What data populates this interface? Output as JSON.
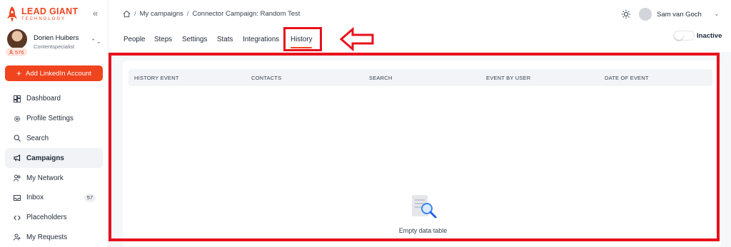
{
  "brand": {
    "name": "LEAD GIANT",
    "tagline": "TECHNOLOGY",
    "accent": "#f0441e"
  },
  "sidebar": {
    "user": {
      "name": "Dorien Huibers",
      "role": "Contentspecialist",
      "credits": "576"
    },
    "add_button": "Add LinkedIn Account",
    "items": [
      {
        "label": "Dashboard",
        "icon": "dashboard-icon"
      },
      {
        "label": "Profile Settings",
        "icon": "gear-icon"
      },
      {
        "label": "Search",
        "icon": "search-icon"
      },
      {
        "label": "Campaigns",
        "icon": "megaphone-icon",
        "active": true
      },
      {
        "label": "My Network",
        "icon": "users-icon"
      },
      {
        "label": "Inbox",
        "icon": "inbox-icon",
        "badge": "57"
      },
      {
        "label": "Placeholders",
        "icon": "code-icon"
      },
      {
        "label": "My Requests",
        "icon": "user-plus-icon"
      }
    ]
  },
  "header": {
    "breadcrumb": {
      "sep": "/",
      "items": [
        "My campaigns",
        "Connector Campaign: Random Test"
      ]
    },
    "user_name": "Sam van Goch"
  },
  "tabs": [
    {
      "label": "People"
    },
    {
      "label": "Steps"
    },
    {
      "label": "Settings"
    },
    {
      "label": "Stats"
    },
    {
      "label": "Integrations"
    },
    {
      "label": "History",
      "active": true
    }
  ],
  "campaign_status": "Inactive",
  "table": {
    "columns": [
      "HISTORY EVENT",
      "CONTACTS",
      "SEARCH",
      "EVENT BY USER",
      "DATE OF EVENT"
    ],
    "empty_label": "Empty data table"
  },
  "annotation_color": "#e8111c"
}
